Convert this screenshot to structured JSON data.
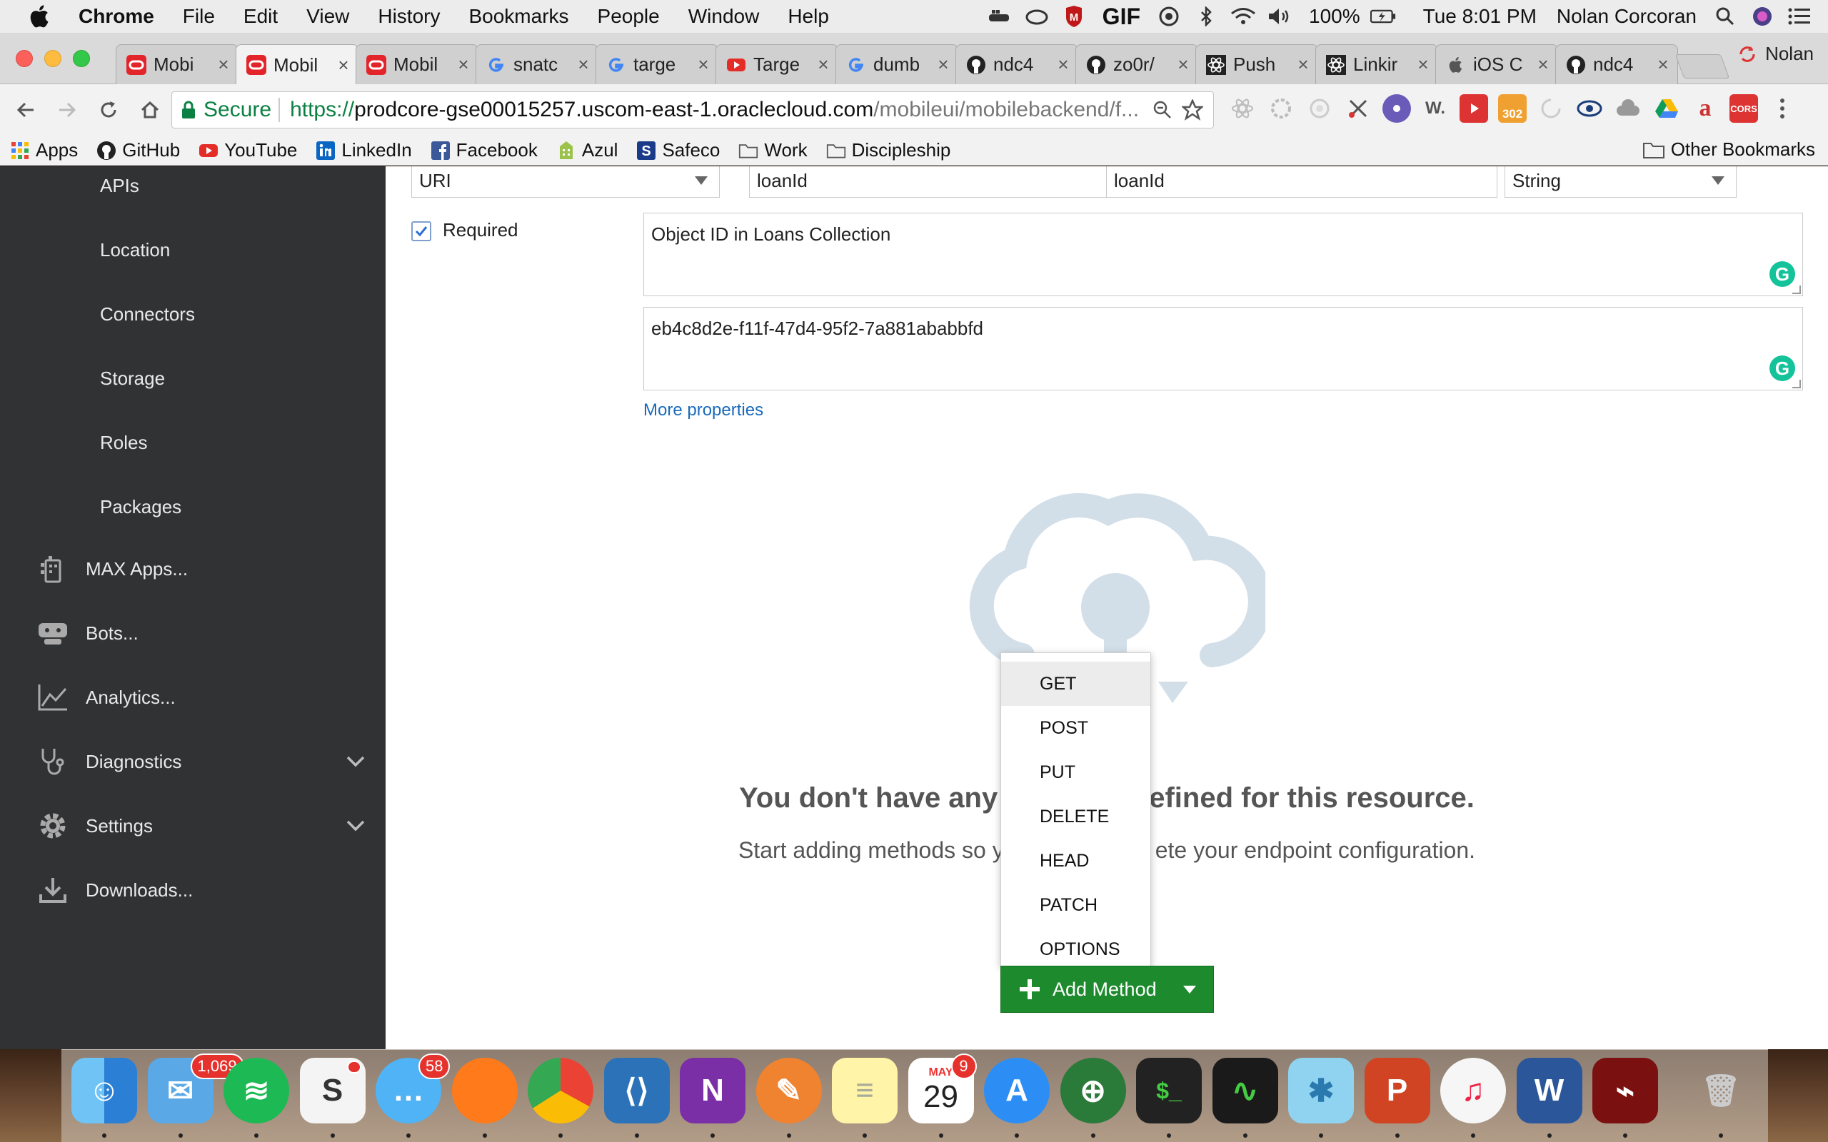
{
  "menubar": {
    "items": [
      "Chrome",
      "File",
      "Edit",
      "View",
      "History",
      "Bookmarks",
      "People",
      "Window",
      "Help"
    ],
    "gif_label": "GIF",
    "battery": "100%",
    "clock": "Tue 8:01 PM",
    "user": "Nolan Corcoran"
  },
  "tabs": [
    {
      "title": "Mobi",
      "favicon": "oracle-icon"
    },
    {
      "title": "Mobil",
      "favicon": "oracle-icon",
      "active": true
    },
    {
      "title": "Mobil",
      "favicon": "oracle-icon"
    },
    {
      "title": "snatc",
      "favicon": "google-icon"
    },
    {
      "title": "targe",
      "favicon": "google-icon"
    },
    {
      "title": "Targe",
      "favicon": "youtube-icon"
    },
    {
      "title": "dumb",
      "favicon": "google-icon"
    },
    {
      "title": "ndc4",
      "favicon": "github-icon"
    },
    {
      "title": "zo0r/",
      "favicon": "github-icon"
    },
    {
      "title": "Push",
      "favicon": "react-icon"
    },
    {
      "title": "Linkir",
      "favicon": "react-icon"
    },
    {
      "title": "iOS C",
      "favicon": "apple-icon"
    },
    {
      "title": "ndc4",
      "favicon": "github-icon"
    }
  ],
  "tab_close": "×",
  "profile_name": "Nolan",
  "address": {
    "secure_label": "Secure",
    "scheme": "https://",
    "host": "prodcore-gse00015257.uscom-east-1.oraclecloud.com",
    "path": "/mobileui/mobilebackend/f..."
  },
  "extensions": [
    "react-devtools",
    "extension-gear",
    "extension-circle",
    "extension-cut",
    "web-developer",
    "extension-w",
    "extension-record",
    "extension-302",
    "extension-spinner",
    "extension-eye",
    "extension-cloud",
    "google-drive",
    "extension-a",
    "cors"
  ],
  "extension_labels": {
    "w": "W.",
    "badge302": "302",
    "a": "a",
    "cors": "CORS"
  },
  "bookmarks": [
    {
      "label": "Apps",
      "icon": "apps-grid-icon"
    },
    {
      "label": "GitHub",
      "icon": "github-icon"
    },
    {
      "label": "YouTube",
      "icon": "youtube-icon"
    },
    {
      "label": "LinkedIn",
      "icon": "linkedin-icon"
    },
    {
      "label": "Facebook",
      "icon": "facebook-icon"
    },
    {
      "label": "Azul",
      "icon": "azul-icon"
    },
    {
      "label": "Safeco",
      "icon": "safeco-icon"
    },
    {
      "label": "Work",
      "icon": "folder-icon"
    },
    {
      "label": "Discipleship",
      "icon": "folder-icon"
    }
  ],
  "other_bookmarks": "Other Bookmarks",
  "sidebar": {
    "subitems": [
      "APIs",
      "Location",
      "Connectors",
      "Storage",
      "Roles",
      "Packages"
    ],
    "main_items": [
      {
        "label": "MAX Apps...",
        "icon": "max-apps-icon"
      },
      {
        "label": "Bots...",
        "icon": "bot-icon"
      },
      {
        "label": "Analytics...",
        "icon": "analytics-icon"
      },
      {
        "label": "Diagnostics",
        "icon": "stethoscope-icon",
        "expandable": true
      },
      {
        "label": "Settings",
        "icon": "gear-icon",
        "expandable": true
      },
      {
        "label": "Downloads...",
        "icon": "download-icon"
      }
    ]
  },
  "param": {
    "type_value": "URI",
    "name_value": "loanId",
    "display_value": "loanId",
    "datatype_value": "String",
    "required_label": "Required",
    "required_checked": true,
    "description_value": "Object ID in Loans Collection",
    "example_value": "eb4c8d2e-f11f-47d4-95f2-7a881ababbfd",
    "more_properties": "More properties"
  },
  "empty_state": {
    "title_left": "You don't have any",
    "title_right": "efined for this resource.",
    "sub_left": "Start adding methods so y",
    "sub_right": "ete your endpoint configuration."
  },
  "method_menu": {
    "options": [
      "GET",
      "POST",
      "PUT",
      "DELETE",
      "HEAD",
      "PATCH",
      "OPTIONS"
    ],
    "highlighted": "GET"
  },
  "add_method_label": "Add Method",
  "dock": {
    "mail_badge": "1,069",
    "messages_badge": "58",
    "calendar_month": "MAY",
    "calendar_day": "29",
    "calendar_badge": "9"
  },
  "colors": {
    "sidebar_bg": "#313234",
    "primary_button": "#1e8a2e",
    "link": "#1a6bb9",
    "secure_green": "#0b8043"
  }
}
